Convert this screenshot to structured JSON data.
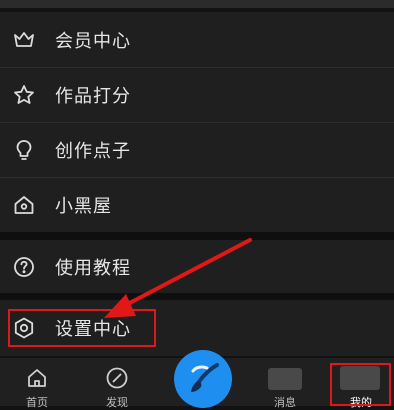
{
  "menu": {
    "vip": "会员中心",
    "rating": "作品打分",
    "ideas": "创作点子",
    "darkroom": "小黑屋",
    "tutorial": "使用教程",
    "settings": "设置中心"
  },
  "tabs": {
    "home": "首页",
    "discover": "发现",
    "messages": "消息",
    "mine": "我的"
  },
  "icons": {
    "vip": "crown-icon",
    "rating": "star-icon",
    "ideas": "lightbulb-icon",
    "darkroom": "house-icon",
    "tutorial": "question-circle-icon",
    "settings": "gear-icon",
    "home": "home-icon",
    "discover": "compass-icon",
    "create": "brush-icon"
  },
  "colors": {
    "background": "#121212",
    "row": "#1f1f1f",
    "accent": "#1e8ff0",
    "annotation": "#e01818"
  }
}
